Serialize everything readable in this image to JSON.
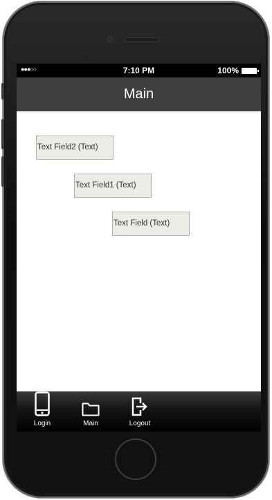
{
  "status_bar": {
    "signal": "●●●○○",
    "time": "7:10 PM",
    "battery": "100%"
  },
  "nav_bar": {
    "title": "Main"
  },
  "fields": [
    {
      "label": "Text Field2 (Text)"
    },
    {
      "label": "Text Field1 (Text)"
    },
    {
      "label": "Text Field (Text)"
    }
  ],
  "tab_bar": {
    "tabs": [
      {
        "label": "Login",
        "icon": "phone-icon"
      },
      {
        "label": "Main",
        "icon": "folder-icon"
      },
      {
        "label": "Logout",
        "icon": "logout-icon"
      }
    ]
  },
  "colors": {
    "nav_bar": "#3f3f3f",
    "field_bg": "#ecebe6",
    "field_border": "#b4b2ab"
  }
}
